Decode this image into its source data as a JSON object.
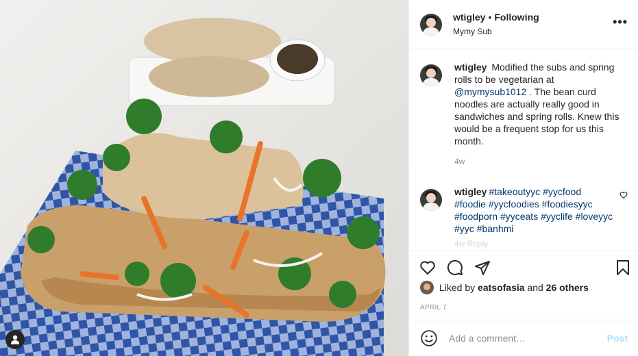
{
  "post": {
    "username": "wtigley",
    "separator": "•",
    "follow_state": "Following",
    "location": "Mymy Sub",
    "more_icon": "more-horizontal-icon"
  },
  "caption": {
    "username": "wtigley",
    "text_before": "Modified the subs and spring rolls to be vegetarian at",
    "mention": "@mymysub1012",
    "text_after": ". The bean curd noodles are actually really good in sandwiches and spring rolls. Knew this would be a frequent stop for us this month.",
    "age": "4w"
  },
  "comment": {
    "username": "wtigley",
    "hashtags": "#takeoutyyc #yycfood #foodie #yycfoodies #foodiesyyc #foodporn #yyceats #yyclife #loveyyc #yyc #banhmi",
    "partial_text": "4w   Reply"
  },
  "actions": {
    "like_icon": "heart-icon",
    "comment_icon": "comment-icon",
    "share_icon": "share-icon",
    "save_icon": "bookmark-icon"
  },
  "likes": {
    "prefix": "Liked by",
    "user": "eatsofasia",
    "joiner": "and",
    "others": "26 others"
  },
  "date": "APRIL 7",
  "add_comment": {
    "emoji_icon": "emoji-icon",
    "placeholder": "Add a comment…",
    "post_label": "Post"
  },
  "colors": {
    "link": "#00376b",
    "muted": "#8e8e8e",
    "post_disabled": "#b2dffc",
    "text": "#262626"
  }
}
